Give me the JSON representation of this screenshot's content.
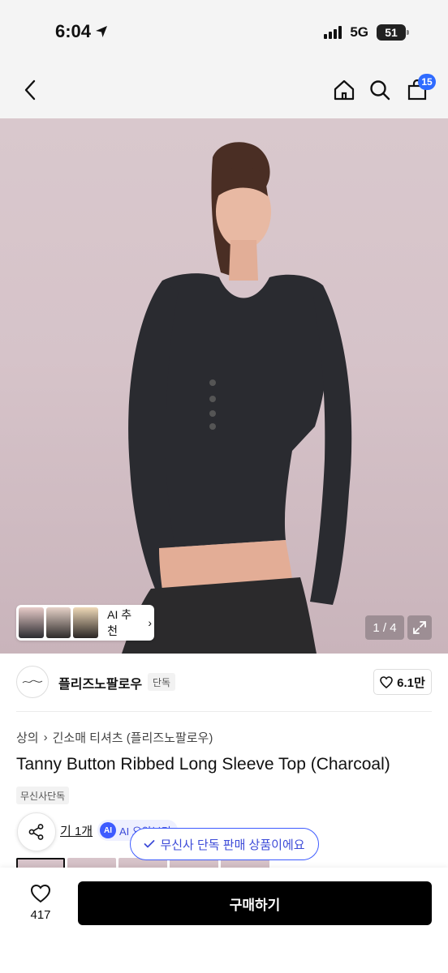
{
  "status": {
    "time": "6:04",
    "network": "5G",
    "battery": "51"
  },
  "header": {
    "cart_count": "15"
  },
  "gallery": {
    "ai_recommend_label": "AI 추천",
    "counter": "1 / 4"
  },
  "brand": {
    "name": "플리즈노팔로우",
    "tag": "단독",
    "likes": "6.1만"
  },
  "breadcrumb": {
    "category": "상의",
    "subcategory": "긴소매 티셔츠 (플리즈노팔로우)"
  },
  "product": {
    "title": "Tanny Button Ribbed Long Sleeve Top (Charcoal)",
    "badge": "무신사단독"
  },
  "reviews": {
    "link_label": "기 1개",
    "ai_label": "AI 요약보기"
  },
  "toast": {
    "text": "무신사 단독 판매 상품이에요"
  },
  "bottom": {
    "wish_count": "417",
    "buy_label": "구매하기"
  },
  "colors": {
    "accent": "#3d5bff",
    "buy_button": "#000000",
    "hero_background": "#d8c6cb"
  }
}
